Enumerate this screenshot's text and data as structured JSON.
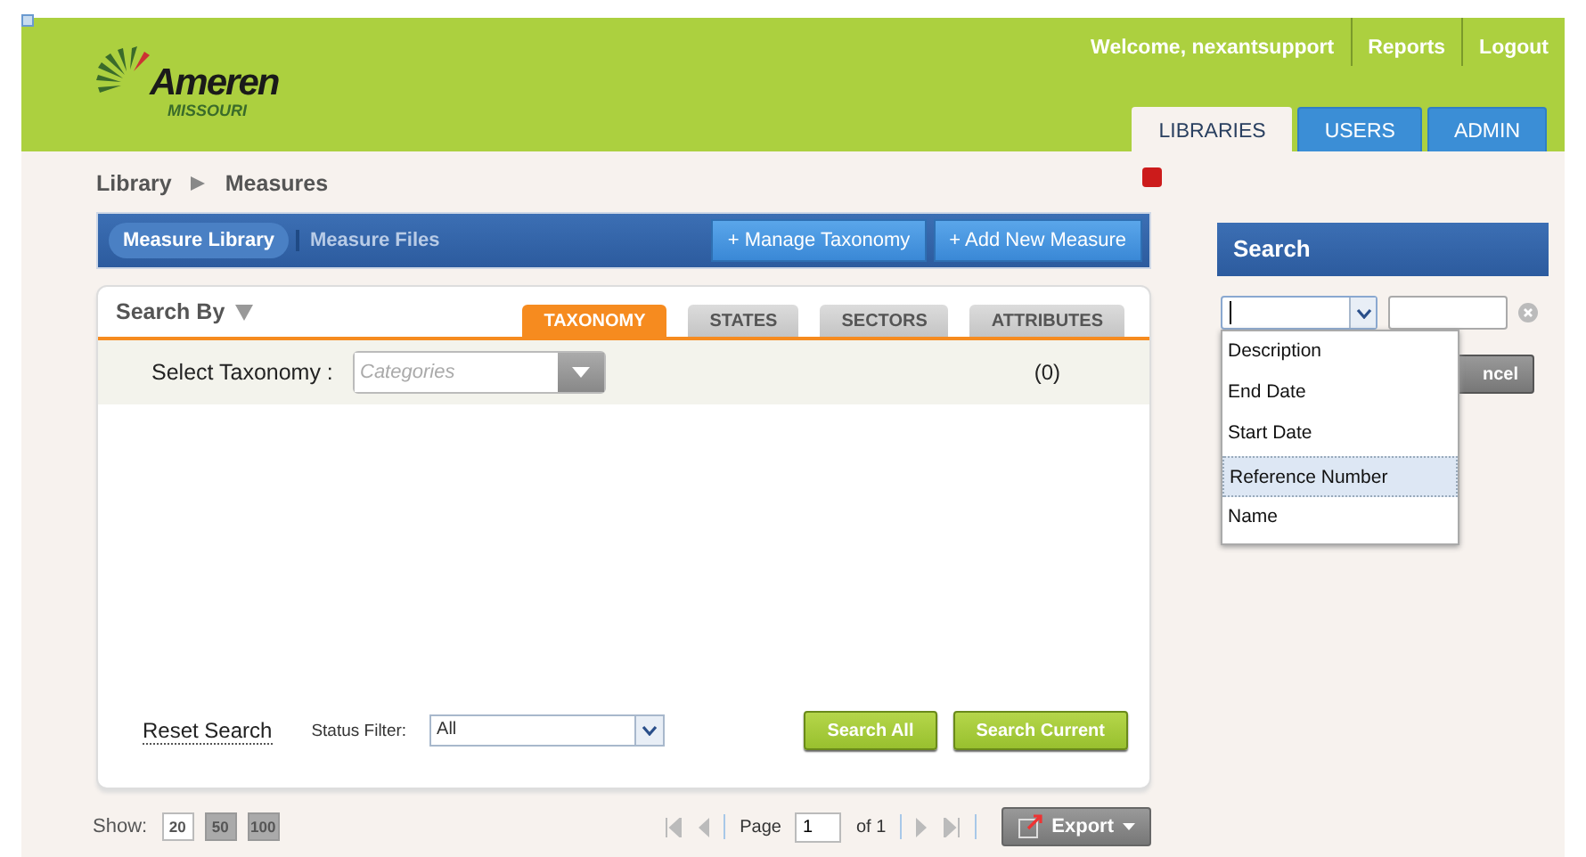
{
  "header": {
    "logo": {
      "name": "Ameren",
      "sub": "MISSOURI"
    },
    "links": [
      "Welcome, nexantsupport",
      "Reports",
      "Logout"
    ],
    "tabs": [
      {
        "label": "LIBRARIES",
        "selected": true
      },
      {
        "label": "USERS",
        "selected": false
      },
      {
        "label": "ADMIN",
        "selected": false
      }
    ]
  },
  "breadcrumb": [
    "Library",
    "Measures"
  ],
  "toolbar": {
    "tabs": [
      {
        "label": "Measure Library",
        "selected": true
      },
      {
        "label": "Measure Files",
        "selected": false
      }
    ],
    "buttons": [
      "+ Manage Taxonomy",
      "+ Add New Measure"
    ]
  },
  "search_by": {
    "title": "Search By",
    "tabs": [
      {
        "label": "TAXONOMY",
        "selected": true
      },
      {
        "label": "STATES",
        "selected": false
      },
      {
        "label": "SECTORS",
        "selected": false
      },
      {
        "label": "ATTRIBUTES",
        "selected": false
      }
    ],
    "taxonomy_label": "Select Taxonomy :",
    "taxonomy_placeholder": "Categories",
    "count": "(0)",
    "reset": "Reset Search",
    "status_label": "Status Filter:",
    "status_value": "All",
    "buttons": [
      "Search All",
      "Search Current"
    ]
  },
  "footer": {
    "show_label": "Show:",
    "page_sizes": [
      {
        "label": "20",
        "selected": true
      },
      {
        "label": "50",
        "selected": false
      },
      {
        "label": "100",
        "selected": false
      }
    ],
    "page_label": "Page",
    "page_value": "1",
    "of": "of 1",
    "export": "Export"
  },
  "search_panel": {
    "title": "Search",
    "cancel_visible": "ncel",
    "options": [
      {
        "label": "Description",
        "selected": false
      },
      {
        "label": "End Date",
        "selected": false
      },
      {
        "label": "Start Date",
        "selected": false
      },
      {
        "label": "Reference Number",
        "selected": true
      },
      {
        "label": "Name",
        "selected": false
      }
    ]
  }
}
